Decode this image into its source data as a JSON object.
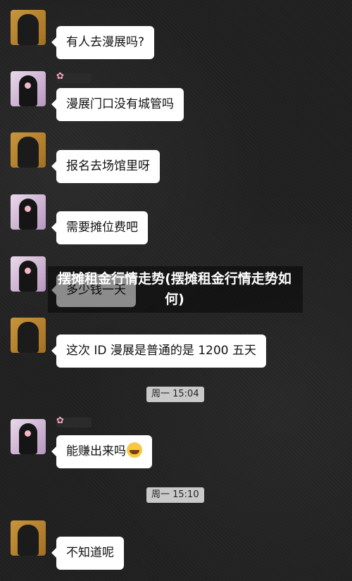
{
  "messages": [
    {
      "text": "有人去漫展吗?"
    },
    {
      "text": "漫展门口没有城管吗"
    },
    {
      "text": "报名去场馆里呀"
    },
    {
      "text": "需要摊位费吧"
    },
    {
      "text": "多少钱一天"
    },
    {
      "text": "这次 ID 漫展是普通的是 1200 五天"
    },
    {
      "text": "能赚出来吗"
    },
    {
      "text": "不知道呢"
    }
  ],
  "timestamps": [
    "周一 15:04",
    "周一 15:10"
  ],
  "overlay_title": "摆摊租金行情走势(摆摊租金行情走势如何)",
  "icons": {
    "emoji": "grinning-sweat-emoji",
    "nick_decoration": "flower-icon"
  },
  "colors": {
    "background": "#202020",
    "bubble": "#ffffff",
    "timestamp_bg": "#c9c9c9"
  }
}
